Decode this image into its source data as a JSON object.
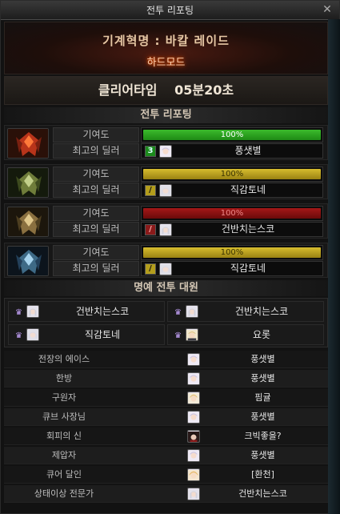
{
  "window": {
    "title": "전투 리포팅",
    "close": "✕"
  },
  "header": {
    "raid_name": "기계혁명 : 바칼 레이드",
    "mode": "하드모드"
  },
  "clear_time": {
    "label": "클리어타임",
    "value": "05분20초"
  },
  "battle_report": {
    "heading": "전투 리포팅",
    "contribution_label": "기여도",
    "best_dealer_label": "최고의 딜러",
    "parties": [
      {
        "emblem": "red-dragon-emblem",
        "contribution_text": "100%",
        "contribution": 1.0,
        "bar_color": "#2ea322",
        "rank_tag": "3",
        "dealer": "풍샛별"
      },
      {
        "emblem": "green-dragon-emblem",
        "contribution_text": "100%",
        "contribution": 1.0,
        "bar_color": "#c2a822",
        "rank_tag": "/",
        "dealer": "직감토네"
      },
      {
        "emblem": "gold-dragon-emblem",
        "contribution_text": "100%",
        "contribution": 1.0,
        "bar_color": "#8e1212",
        "rank_tag": "/",
        "dealer": "건반치는스코"
      },
      {
        "emblem": "blue-dragon-emblem",
        "contribution_text": "100%",
        "contribution": 1.0,
        "bar_color": "#c2a822",
        "rank_tag": "/",
        "dealer": "직감토네"
      }
    ]
  },
  "honor": {
    "heading": "명예 전투 대원",
    "members": [
      "건반치는스코",
      "건반치는스코",
      "직감토네",
      "요롯"
    ]
  },
  "awards": [
    {
      "title": "전장의 에이스",
      "name": "풍샛별"
    },
    {
      "title": "한방",
      "name": "풍샛별"
    },
    {
      "title": "구원자",
      "name": "핌귤"
    },
    {
      "title": "큐브 사장님",
      "name": "풍샛별"
    },
    {
      "title": "회피의 신",
      "name": "크빅좋을?"
    },
    {
      "title": "제압자",
      "name": "풍샛별"
    },
    {
      "title": "큐어 달인",
      "name": "[환천]"
    },
    {
      "title": "상태이상 전문가",
      "name": "건반치는스코"
    }
  ]
}
